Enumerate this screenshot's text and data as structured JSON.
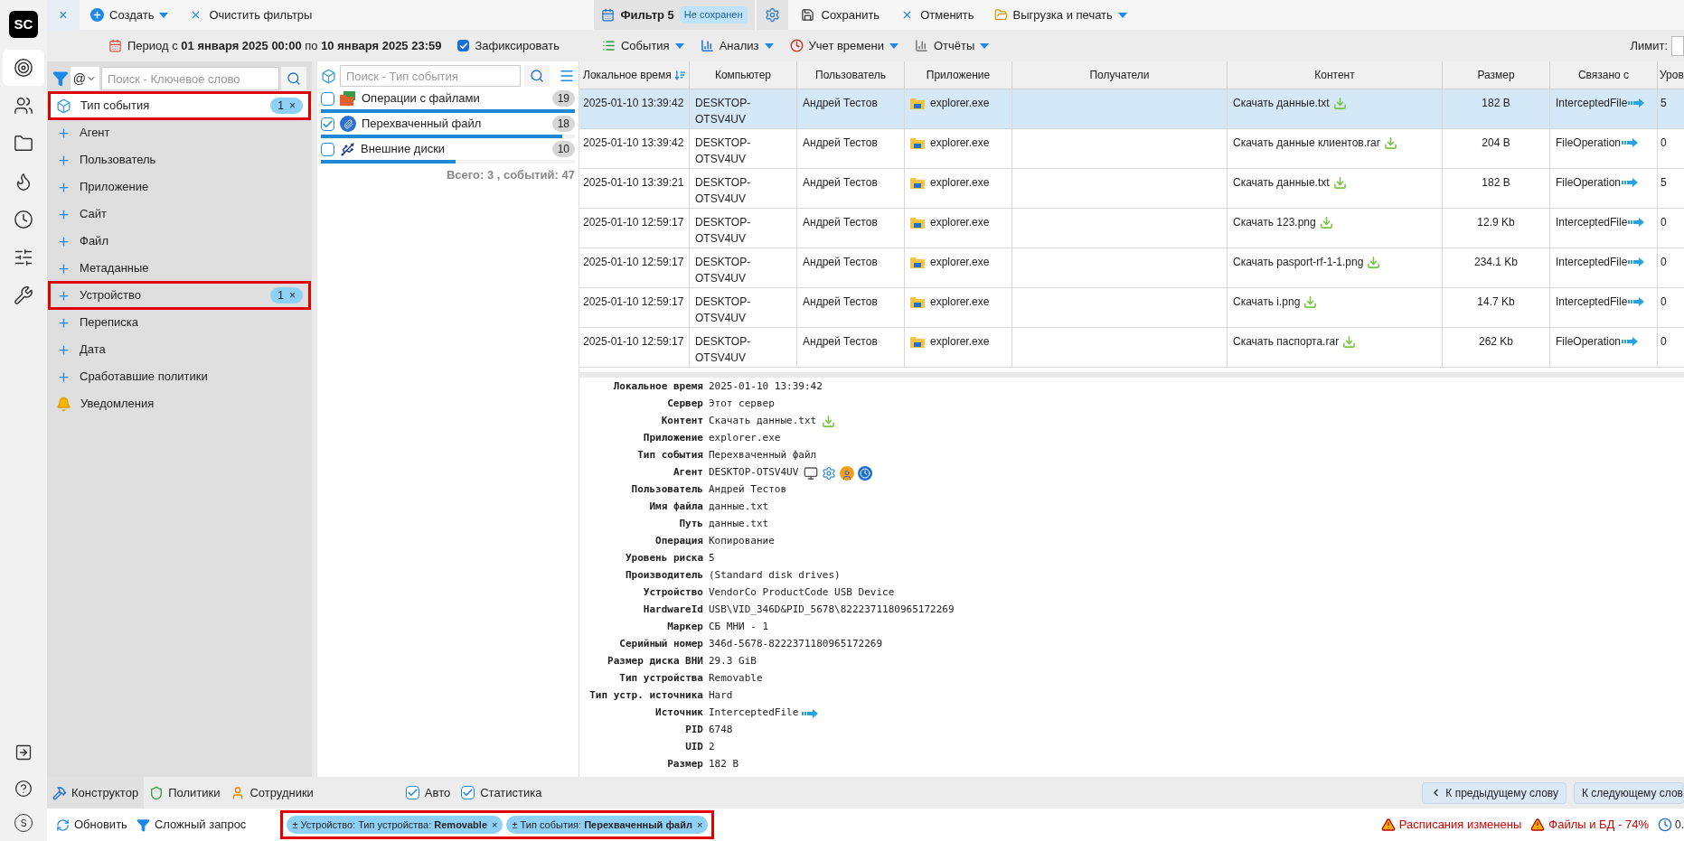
{
  "rail": {
    "logo": "SC",
    "items": [
      {
        "selected": true
      },
      {
        "selected": false
      },
      {
        "selected": false
      },
      {
        "selected": false
      },
      {
        "selected": false
      },
      {
        "selected": false
      },
      {
        "selected": false
      }
    ],
    "avatar": "S"
  },
  "toolbar": {
    "close": "×",
    "create": "Создать",
    "clear": "Очистить фильтры",
    "tab": {
      "label": "Фильтр 5",
      "badge": "Не сохранен"
    },
    "save": "Сохранить",
    "cancel": "Отменить",
    "export": "Выгрузка и печать"
  },
  "period": {
    "text": "Период с **01 января 2025 00:00** по **10 января 2025 23:59**",
    "fix": {
      "label": "Зафиксировать",
      "checked": true
    }
  },
  "menus": [
    "События",
    "Анализ",
    "Учет времени",
    "Отчёты"
  ],
  "limit": {
    "label": "Лимит:"
  },
  "filters": {
    "at": "@",
    "placeholder": "Поиск - Ключевое слово",
    "items": [
      {
        "kind": "type",
        "label": "Тип события",
        "selected": true,
        "highlighted": true,
        "count": "1",
        "remove": "×"
      },
      {
        "kind": "plus",
        "label": "Агент",
        "selected": false,
        "highlighted": false
      },
      {
        "kind": "plus",
        "label": "Пользователь",
        "selected": false,
        "highlighted": false
      },
      {
        "kind": "plus",
        "label": "Приложение",
        "selected": false,
        "highlighted": false
      },
      {
        "kind": "plus",
        "label": "Сайт",
        "selected": false,
        "highlighted": false
      },
      {
        "kind": "plus",
        "label": "Файл",
        "selected": false,
        "highlighted": false
      },
      {
        "kind": "plus",
        "label": "Метаданные",
        "selected": false,
        "highlighted": false
      },
      {
        "kind": "plus",
        "label": "Устройство",
        "selected": false,
        "highlighted": true,
        "count": "1",
        "remove": "×"
      },
      {
        "kind": "plus",
        "label": "Переписка",
        "selected": false,
        "highlighted": false
      },
      {
        "kind": "plus",
        "label": "Дата",
        "selected": false,
        "highlighted": false
      },
      {
        "kind": "plus",
        "label": "Сработавшие политики",
        "selected": false,
        "highlighted": false
      },
      {
        "kind": "bell",
        "label": "Уведомления",
        "selected": false,
        "highlighted": false
      }
    ]
  },
  "event_types": {
    "placeholder": "Поиск - Тип события",
    "items": [
      {
        "kind": "folders",
        "label": "Операции с файлами",
        "checked": false,
        "count": "19",
        "level": 1.0
      },
      {
        "kind": "clip",
        "label": "Перехваченный файл",
        "checked": true,
        "count": "18",
        "level": 0.95
      },
      {
        "kind": "drive",
        "label": "Внешние диски",
        "checked": false,
        "count": "10",
        "level": 0.53
      }
    ],
    "total": "Всего: 3 , событий: 47"
  },
  "table": {
    "columns": [
      "Локальное время",
      "Компьютер",
      "Пользователь",
      "Приложение",
      "Получатели",
      "Контент",
      "Размер",
      "Связано с",
      "Уров"
    ],
    "rows": [
      {
        "selected": true,
        "time": "2025-01-10 13:39:42",
        "computer": "DESKTOP-OTSV4UV",
        "user": "Андрей Тестов",
        "app": "explorer.exe",
        "content": "Скачать данные.txt",
        "size": "182 B",
        "related": "InterceptedFile",
        "level_col": "5"
      },
      {
        "selected": false,
        "time": "2025-01-10 13:39:42",
        "computer": "DESKTOP-OTSV4UV",
        "user": "Андрей Тестов",
        "app": "explorer.exe",
        "content": "Скачать данные клиентов.rar",
        "size": "204 B",
        "related": "FileOperation",
        "level_col": "0"
      },
      {
        "selected": false,
        "time": "2025-01-10 13:39:21",
        "computer": "DESKTOP-OTSV4UV",
        "user": "Андрей Тестов",
        "app": "explorer.exe",
        "content": "Скачать данные.txt",
        "size": "182 B",
        "related": "FileOperation",
        "level_col": "5"
      },
      {
        "selected": false,
        "time": "2025-01-10 12:59:17",
        "computer": "DESKTOP-OTSV4UV",
        "user": "Андрей Тестов",
        "app": "explorer.exe",
        "content": "Скачать 123.png",
        "size": "12.9 Kb",
        "related": "InterceptedFile",
        "level_col": "0"
      },
      {
        "selected": false,
        "time": "2025-01-10 12:59:17",
        "computer": "DESKTOP-OTSV4UV",
        "user": "Андрей Тестов",
        "app": "explorer.exe",
        "content": "Скачать pasport-rf-1-1.png",
        "size": "234.1 Kb",
        "related": "InterceptedFile",
        "level_col": "0"
      },
      {
        "selected": false,
        "time": "2025-01-10 12:59:17",
        "computer": "DESKTOP-OTSV4UV",
        "user": "Андрей Тестов",
        "app": "explorer.exe",
        "content": "Скачать i.png",
        "size": "14.7 Kb",
        "related": "InterceptedFile",
        "level_col": "0"
      },
      {
        "selected": false,
        "time": "2025-01-10 12:59:17",
        "computer": "DESKTOP-OTSV4UV",
        "user": "Андрей Тестов",
        "app": "explorer.exe",
        "content": "Скачать паспорта.rar",
        "size": "262 Kb",
        "related": "FileOperation",
        "level_col": "0"
      }
    ]
  },
  "details": [
    {
      "kind": "text",
      "label": "Локальное время",
      "value": "2025-01-10 13:39:42"
    },
    {
      "kind": "text",
      "label": "Сервер",
      "value": "Этот сервер"
    },
    {
      "kind": "download",
      "label": "Контент",
      "value": "Скачать данные.txt"
    },
    {
      "kind": "app",
      "label": "Приложение",
      "value": "explorer.exe"
    },
    {
      "kind": "event",
      "label": "Тип события",
      "value": "Перехваченный файл"
    },
    {
      "kind": "agent",
      "label": "Агент",
      "value": "DESKTOP-OTSV4UV"
    },
    {
      "kind": "text",
      "label": "Пользователь",
      "value": "Андрей Тестов"
    },
    {
      "kind": "text",
      "label": "Имя файла",
      "value": "данные.txt"
    },
    {
      "kind": "text",
      "label": "Путь",
      "value": "данные.txt"
    },
    {
      "kind": "text",
      "label": "Операция",
      "value": "Копирование"
    },
    {
      "kind": "text",
      "label": "Уровень риска",
      "value": "5"
    },
    {
      "kind": "text",
      "label": "Производитель",
      "value": "(Standard disk drives)"
    },
    {
      "kind": "text",
      "label": "Устройство",
      "value": "VendorCo ProductCode USB Device"
    },
    {
      "kind": "text",
      "label": "HardwareId",
      "value": "USB\\VID_346D&PID_5678\\8222371180965172269"
    },
    {
      "kind": "text",
      "label": "Маркер",
      "value": "СБ МНИ - 1"
    },
    {
      "kind": "text",
      "label": "Серийный номер",
      "value": "346d-5678-8222371180965172269"
    },
    {
      "kind": "text",
      "label": "Размер диска ВНИ",
      "value": "29.3 GiB"
    },
    {
      "kind": "text",
      "label": "Тип устройства",
      "value": "Removable"
    },
    {
      "kind": "text",
      "label": "Тип устр. источника",
      "value": "Hard"
    },
    {
      "kind": "link",
      "label": "Источник",
      "value": "InterceptedFile"
    },
    {
      "kind": "text",
      "label": "PID",
      "value": "6748"
    },
    {
      "kind": "text",
      "label": "UID",
      "value": "2"
    },
    {
      "kind": "text",
      "label": "Размер",
      "value": "182 B"
    }
  ],
  "bottom_tabs": [
    {
      "label": "Конструктор",
      "selected": true
    },
    {
      "label": "Политики",
      "selected": false
    },
    {
      "label": "Сотрудники",
      "selected": false
    }
  ],
  "options": [
    {
      "label": "Авто",
      "checked": true
    },
    {
      "label": "Статистика",
      "checked": true
    }
  ],
  "nav": {
    "prev": "К предыдущему слову",
    "next": "К следующему слов"
  },
  "status_bar": {
    "refresh": "Обновить",
    "complex": "Сложный запрос",
    "chips_highlighted": true,
    "chips": [
      {
        "text": "± Устройство: Тип устройства: **Removable**",
        "remove": "×"
      },
      {
        "text": "± Тип события: **Перехваченный файл**",
        "remove": "×"
      }
    ],
    "warnings": [
      {
        "text": "Расписания изменены",
        "color": "#d40000"
      },
      {
        "text": "Файлы и БД - 74%",
        "color": "#c00000"
      }
    ],
    "time": "0."
  }
}
